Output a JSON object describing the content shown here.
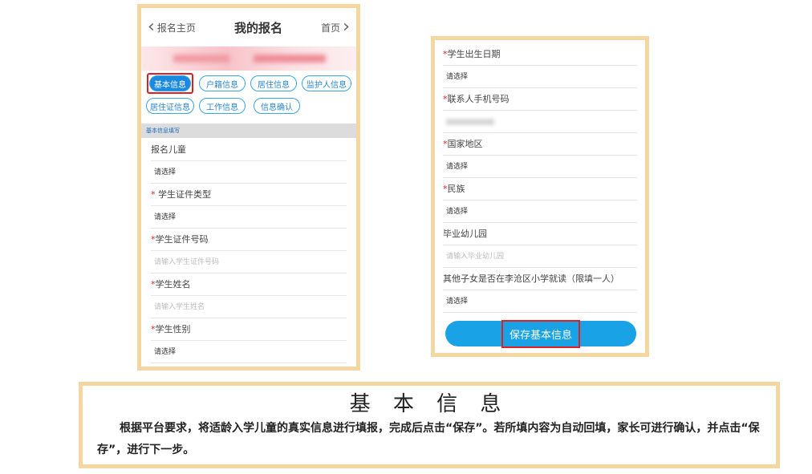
{
  "left_phone": {
    "nav": {
      "back_label": "报名主页",
      "title": "我的报名",
      "home_label": "首页"
    },
    "tabs": [
      {
        "label": "基本信息",
        "active": true
      },
      {
        "label": "户籍信息",
        "active": false
      },
      {
        "label": "居住信息",
        "active": false
      },
      {
        "label": "监护人信息",
        "active": false
      },
      {
        "label": "居住证信息",
        "active": false
      },
      {
        "label": "工作信息",
        "active": false
      },
      {
        "label": "信息确认",
        "active": false
      }
    ],
    "section_label": "基本信息填写",
    "fields": [
      {
        "label": "报名儿童",
        "required": false,
        "value": "请选择",
        "placeholder": ""
      },
      {
        "label": "学生证件类型",
        "required": true,
        "value": "请选择",
        "placeholder": ""
      },
      {
        "label": "学生证件号码",
        "required": true,
        "value": "",
        "placeholder": "请输入学生证件号码"
      },
      {
        "label": "学生姓名",
        "required": true,
        "value": "",
        "placeholder": "请输入学生姓名"
      },
      {
        "label": "学生性别",
        "required": true,
        "value": "请选择",
        "placeholder": ""
      }
    ]
  },
  "right_phone": {
    "fields": [
      {
        "label": "学生出生日期",
        "required": true,
        "value": "请选择",
        "placeholder": ""
      },
      {
        "label": "联系人手机号码",
        "required": true,
        "value": "",
        "placeholder": "",
        "blurred": true
      },
      {
        "label": "国家地区",
        "required": true,
        "value": "请选择",
        "placeholder": ""
      },
      {
        "label": "民族",
        "required": true,
        "value": "请选择",
        "placeholder": ""
      },
      {
        "label": "毕业幼儿园",
        "required": false,
        "value": "",
        "placeholder": "请输入毕业幼儿园"
      },
      {
        "label": "其他子女是否在李沧区小学就读（限填一人）",
        "required": false,
        "value": "请选择",
        "placeholder": ""
      }
    ],
    "save_label": "保存基本信息"
  },
  "caption": {
    "title": "基 本 信 息",
    "body": "根据平台要求，将适龄入学儿童的真实信息进行填报，完成后点击“保存”。若所填内容为自动回填，家长可进行确认，并点击“保存”，进行下一步。"
  },
  "colors": {
    "accent": "#1a8ae0",
    "highlight": "#e02020",
    "frame": "#f3d6a0",
    "required": "#e02020"
  }
}
